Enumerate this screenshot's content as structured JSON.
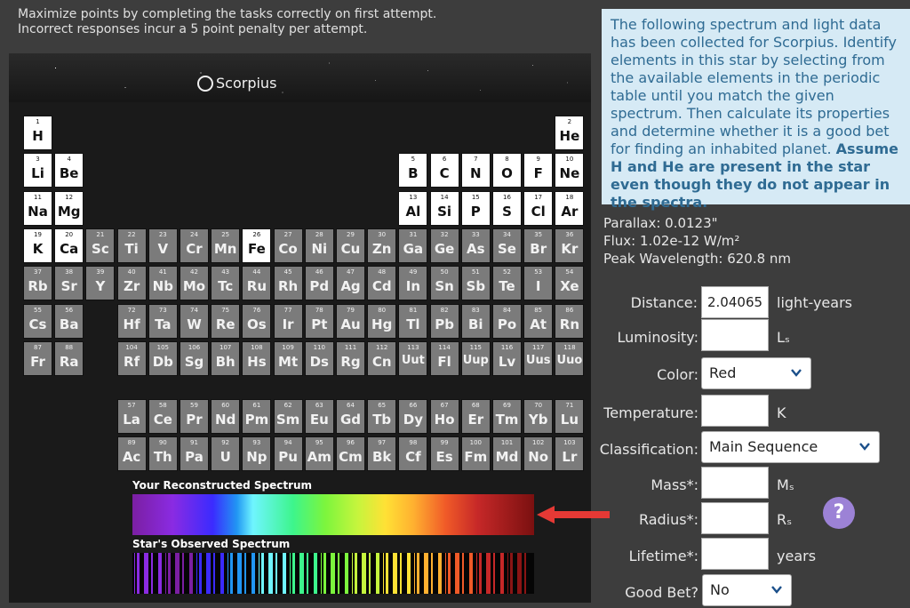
{
  "instructions": {
    "line1": "Maximize points by completing the tasks correctly on first attempt.",
    "line2": "Incorrect responses incur a 5 point penalty per attempt."
  },
  "star_name": "Scorpius",
  "info_text": {
    "normal": "The following spectrum and light data has been collected for Scorpius. Identify elements in this star by selecting from the available elements in the periodic table until you match the given spectrum. Then calculate its properties and determine whether it is a good bet for finding an inhabited planet. ",
    "bold": "Assume H and He are present in the star even though they do not appear in the spectra."
  },
  "measurements": {
    "parallax": "Parallax: 0.0123\"",
    "flux": "Flux: 1.02e-12 W/m²",
    "peak": "Peak Wavelength: 620.8 nm"
  },
  "form": {
    "distance": {
      "label": "Distance:",
      "value": "2.04065",
      "unit": "light-years"
    },
    "luminosity": {
      "label": "Luminosity:",
      "value": "",
      "unit": "Lₛ"
    },
    "color": {
      "label": "Color:",
      "selected": "Red"
    },
    "temperature": {
      "label": "Temperature:",
      "value": "",
      "unit": "K"
    },
    "classification": {
      "label": "Classification:",
      "selected": "Main Sequence"
    },
    "mass": {
      "label": "Mass*:",
      "value": "",
      "unit": "Mₛ"
    },
    "radius": {
      "label": "Radius*:",
      "value": "",
      "unit": "Rₛ"
    },
    "lifetime": {
      "label": "Lifetime*:",
      "value": "",
      "unit": "years"
    },
    "good_bet": {
      "label": "Good Bet?",
      "selected": "No"
    }
  },
  "help_label": "?",
  "spectrum": {
    "reconstructed_title": "Your Reconstructed Spectrum",
    "observed_title": "Star's Observed Spectrum"
  },
  "periodic_table": {
    "selected": [
      "H",
      "He",
      "Li",
      "Be",
      "Na",
      "Mg",
      "K",
      "Ca",
      "Fe",
      "B",
      "C",
      "N",
      "O",
      "F",
      "Ne",
      "Al",
      "Si",
      "P",
      "S",
      "Cl",
      "Ar"
    ],
    "elements": [
      {
        "n": "1",
        "s": "H",
        "r": 0,
        "c": 0
      },
      {
        "n": "2",
        "s": "He",
        "r": 0,
        "c": 17
      },
      {
        "n": "3",
        "s": "Li",
        "r": 1,
        "c": 0
      },
      {
        "n": "4",
        "s": "Be",
        "r": 1,
        "c": 1
      },
      {
        "n": "5",
        "s": "B",
        "r": 1,
        "c": 12
      },
      {
        "n": "6",
        "s": "C",
        "r": 1,
        "c": 13
      },
      {
        "n": "7",
        "s": "N",
        "r": 1,
        "c": 14
      },
      {
        "n": "8",
        "s": "O",
        "r": 1,
        "c": 15
      },
      {
        "n": "9",
        "s": "F",
        "r": 1,
        "c": 16
      },
      {
        "n": "10",
        "s": "Ne",
        "r": 1,
        "c": 17
      },
      {
        "n": "11",
        "s": "Na",
        "r": 2,
        "c": 0
      },
      {
        "n": "12",
        "s": "Mg",
        "r": 2,
        "c": 1
      },
      {
        "n": "13",
        "s": "Al",
        "r": 2,
        "c": 12
      },
      {
        "n": "14",
        "s": "Si",
        "r": 2,
        "c": 13
      },
      {
        "n": "15",
        "s": "P",
        "r": 2,
        "c": 14
      },
      {
        "n": "16",
        "s": "S",
        "r": 2,
        "c": 15
      },
      {
        "n": "17",
        "s": "Cl",
        "r": 2,
        "c": 16
      },
      {
        "n": "18",
        "s": "Ar",
        "r": 2,
        "c": 17
      },
      {
        "n": "19",
        "s": "K",
        "r": 3,
        "c": 0
      },
      {
        "n": "20",
        "s": "Ca",
        "r": 3,
        "c": 1
      },
      {
        "n": "21",
        "s": "Sc",
        "r": 3,
        "c": 2
      },
      {
        "n": "22",
        "s": "Ti",
        "r": 3,
        "c": 3
      },
      {
        "n": "23",
        "s": "V",
        "r": 3,
        "c": 4
      },
      {
        "n": "24",
        "s": "Cr",
        "r": 3,
        "c": 5
      },
      {
        "n": "25",
        "s": "Mn",
        "r": 3,
        "c": 6
      },
      {
        "n": "26",
        "s": "Fe",
        "r": 3,
        "c": 7
      },
      {
        "n": "27",
        "s": "Co",
        "r": 3,
        "c": 8
      },
      {
        "n": "28",
        "s": "Ni",
        "r": 3,
        "c": 9
      },
      {
        "n": "29",
        "s": "Cu",
        "r": 3,
        "c": 10
      },
      {
        "n": "30",
        "s": "Zn",
        "r": 3,
        "c": 11
      },
      {
        "n": "31",
        "s": "Ga",
        "r": 3,
        "c": 12
      },
      {
        "n": "32",
        "s": "Ge",
        "r": 3,
        "c": 13
      },
      {
        "n": "33",
        "s": "As",
        "r": 3,
        "c": 14
      },
      {
        "n": "34",
        "s": "Se",
        "r": 3,
        "c": 15
      },
      {
        "n": "35",
        "s": "Br",
        "r": 3,
        "c": 16
      },
      {
        "n": "36",
        "s": "Kr",
        "r": 3,
        "c": 17
      },
      {
        "n": "37",
        "s": "Rb",
        "r": 4,
        "c": 0
      },
      {
        "n": "38",
        "s": "Sr",
        "r": 4,
        "c": 1
      },
      {
        "n": "39",
        "s": "Y",
        "r": 4,
        "c": 2
      },
      {
        "n": "40",
        "s": "Zr",
        "r": 4,
        "c": 3
      },
      {
        "n": "41",
        "s": "Nb",
        "r": 4,
        "c": 4
      },
      {
        "n": "42",
        "s": "Mo",
        "r": 4,
        "c": 5
      },
      {
        "n": "43",
        "s": "Tc",
        "r": 4,
        "c": 6
      },
      {
        "n": "44",
        "s": "Ru",
        "r": 4,
        "c": 7
      },
      {
        "n": "45",
        "s": "Rh",
        "r": 4,
        "c": 8
      },
      {
        "n": "46",
        "s": "Pd",
        "r": 4,
        "c": 9
      },
      {
        "n": "47",
        "s": "Ag",
        "r": 4,
        "c": 10
      },
      {
        "n": "48",
        "s": "Cd",
        "r": 4,
        "c": 11
      },
      {
        "n": "49",
        "s": "In",
        "r": 4,
        "c": 12
      },
      {
        "n": "50",
        "s": "Sn",
        "r": 4,
        "c": 13
      },
      {
        "n": "51",
        "s": "Sb",
        "r": 4,
        "c": 14
      },
      {
        "n": "52",
        "s": "Te",
        "r": 4,
        "c": 15
      },
      {
        "n": "53",
        "s": "I",
        "r": 4,
        "c": 16
      },
      {
        "n": "54",
        "s": "Xe",
        "r": 4,
        "c": 17
      },
      {
        "n": "55",
        "s": "Cs",
        "r": 5,
        "c": 0
      },
      {
        "n": "56",
        "s": "Ba",
        "r": 5,
        "c": 1
      },
      {
        "n": "72",
        "s": "Hf",
        "r": 5,
        "c": 3
      },
      {
        "n": "73",
        "s": "Ta",
        "r": 5,
        "c": 4
      },
      {
        "n": "74",
        "s": "W",
        "r": 5,
        "c": 5
      },
      {
        "n": "75",
        "s": "Re",
        "r": 5,
        "c": 6
      },
      {
        "n": "76",
        "s": "Os",
        "r": 5,
        "c": 7
      },
      {
        "n": "77",
        "s": "Ir",
        "r": 5,
        "c": 8
      },
      {
        "n": "78",
        "s": "Pt",
        "r": 5,
        "c": 9
      },
      {
        "n": "79",
        "s": "Au",
        "r": 5,
        "c": 10
      },
      {
        "n": "80",
        "s": "Hg",
        "r": 5,
        "c": 11
      },
      {
        "n": "81",
        "s": "Tl",
        "r": 5,
        "c": 12
      },
      {
        "n": "82",
        "s": "Pb",
        "r": 5,
        "c": 13
      },
      {
        "n": "83",
        "s": "Bi",
        "r": 5,
        "c": 14
      },
      {
        "n": "84",
        "s": "Po",
        "r": 5,
        "c": 15
      },
      {
        "n": "85",
        "s": "At",
        "r": 5,
        "c": 16
      },
      {
        "n": "86",
        "s": "Rn",
        "r": 5,
        "c": 17
      },
      {
        "n": "87",
        "s": "Fr",
        "r": 6,
        "c": 0
      },
      {
        "n": "88",
        "s": "Ra",
        "r": 6,
        "c": 1
      },
      {
        "n": "104",
        "s": "Rf",
        "r": 6,
        "c": 3
      },
      {
        "n": "105",
        "s": "Db",
        "r": 6,
        "c": 4
      },
      {
        "n": "106",
        "s": "Sg",
        "r": 6,
        "c": 5
      },
      {
        "n": "107",
        "s": "Bh",
        "r": 6,
        "c": 6
      },
      {
        "n": "108",
        "s": "Hs",
        "r": 6,
        "c": 7
      },
      {
        "n": "109",
        "s": "Mt",
        "r": 6,
        "c": 8
      },
      {
        "n": "110",
        "s": "Ds",
        "r": 6,
        "c": 9
      },
      {
        "n": "111",
        "s": "Rg",
        "r": 6,
        "c": 10
      },
      {
        "n": "112",
        "s": "Cn",
        "r": 6,
        "c": 11
      },
      {
        "n": "113",
        "s": "Uut",
        "r": 6,
        "c": 12
      },
      {
        "n": "114",
        "s": "Fl",
        "r": 6,
        "c": 13
      },
      {
        "n": "115",
        "s": "Uup",
        "r": 6,
        "c": 14
      },
      {
        "n": "116",
        "s": "Lv",
        "r": 6,
        "c": 15
      },
      {
        "n": "117",
        "s": "Uus",
        "r": 6,
        "c": 16
      },
      {
        "n": "118",
        "s": "Uuo",
        "r": 6,
        "c": 17
      },
      {
        "n": "57",
        "s": "La",
        "r": 7,
        "c": 3
      },
      {
        "n": "58",
        "s": "Ce",
        "r": 7,
        "c": 4
      },
      {
        "n": "59",
        "s": "Pr",
        "r": 7,
        "c": 5
      },
      {
        "n": "60",
        "s": "Nd",
        "r": 7,
        "c": 6
      },
      {
        "n": "61",
        "s": "Pm",
        "r": 7,
        "c": 7
      },
      {
        "n": "62",
        "s": "Sm",
        "r": 7,
        "c": 8
      },
      {
        "n": "63",
        "s": "Eu",
        "r": 7,
        "c": 9
      },
      {
        "n": "64",
        "s": "Gd",
        "r": 7,
        "c": 10
      },
      {
        "n": "65",
        "s": "Tb",
        "r": 7,
        "c": 11
      },
      {
        "n": "66",
        "s": "Dy",
        "r": 7,
        "c": 12
      },
      {
        "n": "67",
        "s": "Ho",
        "r": 7,
        "c": 13
      },
      {
        "n": "68",
        "s": "Er",
        "r": 7,
        "c": 14
      },
      {
        "n": "69",
        "s": "Tm",
        "r": 7,
        "c": 15
      },
      {
        "n": "70",
        "s": "Yb",
        "r": 7,
        "c": 16
      },
      {
        "n": "71",
        "s": "Lu",
        "r": 7,
        "c": 17
      },
      {
        "n": "89",
        "s": "Ac",
        "r": 8,
        "c": 3
      },
      {
        "n": "90",
        "s": "Th",
        "r": 8,
        "c": 4
      },
      {
        "n": "91",
        "s": "Pa",
        "r": 8,
        "c": 5
      },
      {
        "n": "92",
        "s": "U",
        "r": 8,
        "c": 6
      },
      {
        "n": "93",
        "s": "Np",
        "r": 8,
        "c": 7
      },
      {
        "n": "94",
        "s": "Pu",
        "r": 8,
        "c": 8
      },
      {
        "n": "95",
        "s": "Am",
        "r": 8,
        "c": 9
      },
      {
        "n": "96",
        "s": "Cm",
        "r": 8,
        "c": 10
      },
      {
        "n": "97",
        "s": "Bk",
        "r": 8,
        "c": 11
      },
      {
        "n": "98",
        "s": "Cf",
        "r": 8,
        "c": 12
      },
      {
        "n": "99",
        "s": "Es",
        "r": 8,
        "c": 13
      },
      {
        "n": "100",
        "s": "Fm",
        "r": 8,
        "c": 14
      },
      {
        "n": "101",
        "s": "Md",
        "r": 8,
        "c": 15
      },
      {
        "n": "102",
        "s": "No",
        "r": 8,
        "c": 16
      },
      {
        "n": "103",
        "s": "Lr",
        "r": 8,
        "c": 17
      }
    ]
  },
  "colors": {
    "info_bg": "#d6eaf5",
    "info_text": "#2f6b93",
    "help": "#9c82d6",
    "arrow": "#e53935"
  }
}
